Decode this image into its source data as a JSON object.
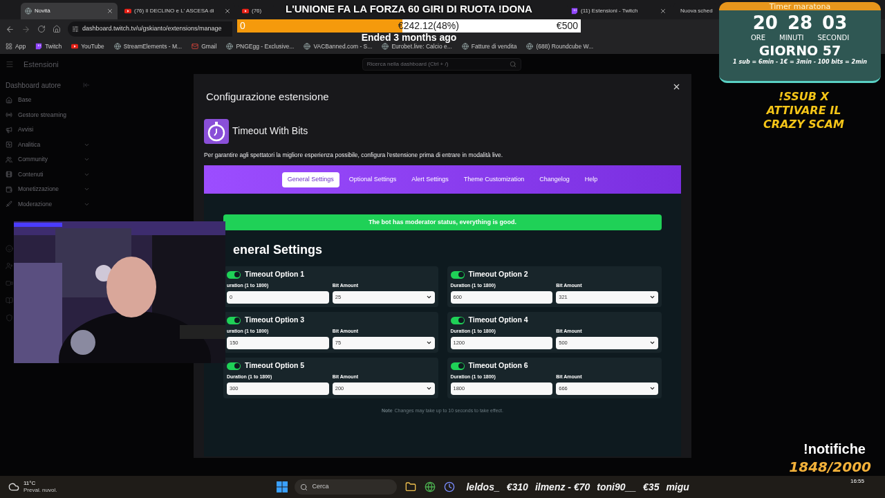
{
  "browser": {
    "tabs": [
      {
        "title": "Novità",
        "selected": true,
        "kind": "globe"
      },
      {
        "title": "(76) Il DECLINO e L' ASCESA di",
        "selected": false,
        "kind": "youtube"
      },
      {
        "title": "(76)",
        "selected": false,
        "kind": "youtube"
      },
      {
        "title": "(11) Estensioni - Twitch",
        "selected": false,
        "kind": "twitch"
      },
      {
        "title": "Nuova sched",
        "selected": false,
        "kind": "globe"
      }
    ],
    "address": "dashboard.twitch.tv/u/gskianto/extensions/manage",
    "bookmarks": [
      {
        "label": "App",
        "kind": "apps"
      },
      {
        "label": "Twitch",
        "kind": "twitch"
      },
      {
        "label": "YouTube",
        "kind": "youtube"
      },
      {
        "label": "StreamElements - M...",
        "kind": "globe"
      },
      {
        "label": "Gmail",
        "kind": "mail"
      },
      {
        "label": "PNGEgg - Exclusive...",
        "kind": "globe"
      },
      {
        "label": "VACBanned.com - S...",
        "kind": "globe"
      },
      {
        "label": "Eurobet.live: Calcio e...",
        "kind": "globe"
      },
      {
        "label": "Fatture di vendita",
        "kind": "globe"
      },
      {
        "label": "(688) Roundcube W...",
        "kind": "globe"
      }
    ]
  },
  "dashboard": {
    "section": "Estensioni",
    "search": {
      "placeholder": "Ricerca nella dashboard (Ctrl + /)"
    },
    "sidebar": {
      "title": "Dashboard autore",
      "items": [
        {
          "label": "Base",
          "has_submenu": false
        },
        {
          "label": "Gestore streaming",
          "has_submenu": false
        },
        {
          "label": "Avvisi",
          "has_submenu": false
        },
        {
          "label": "Analitica",
          "has_submenu": true
        },
        {
          "label": "Community",
          "has_submenu": true
        },
        {
          "label": "Contenuti",
          "has_submenu": true
        },
        {
          "label": "Monetizzazione",
          "has_submenu": true
        },
        {
          "label": "Moderazione",
          "has_submenu": true
        }
      ]
    }
  },
  "modal": {
    "title": "Configurazione estensione",
    "extension": "Timeout With Bits",
    "description": "Per garantire agli spettatori la migliore esperienza possibile, configura l'estensione prima di entrare in modalità live.",
    "tabs": [
      {
        "label": "General Settings",
        "selected": true
      },
      {
        "label": "Optional Settings",
        "selected": false
      },
      {
        "label": "Alert Settings",
        "selected": false
      },
      {
        "label": "Theme Customization",
        "selected": false
      },
      {
        "label": "Changelog",
        "selected": false
      },
      {
        "label": "Help",
        "selected": false
      }
    ],
    "banner": "The bot has moderator status, everything is good.",
    "heading": "eneral Settings",
    "options": [
      {
        "title": "Timeout Option 1",
        "enabled": true,
        "duration_label": "uration (1 to 1800)",
        "duration": "0",
        "bit_label": "Bit Amount",
        "bits": "25"
      },
      {
        "title": "Timeout Option 2",
        "enabled": true,
        "duration_label": "Duration (1 to 1800)",
        "duration": "600",
        "bit_label": "Bit Amount",
        "bits": "321"
      },
      {
        "title": "Timeout Option 3",
        "enabled": true,
        "duration_label": "uration (1 to 1800)",
        "duration": "150",
        "bit_label": "Bit Amount",
        "bits": "75"
      },
      {
        "title": "Timeout Option 4",
        "enabled": true,
        "duration_label": "Duration (1 to 1800)",
        "duration": "1200",
        "bit_label": "Bit Amount",
        "bits": "500"
      },
      {
        "title": "Timeout Option 5",
        "enabled": true,
        "duration_label": "Duration (1 to 1800)",
        "duration": "300",
        "bit_label": "Bit Amount",
        "bits": "200"
      },
      {
        "title": "Timeout Option 6",
        "enabled": true,
        "duration_label": "Duration (1 to 1800)",
        "duration": "1800",
        "bit_label": "Bit Amount",
        "bits": "666"
      }
    ],
    "note": {
      "label": "Note",
      "text": "Changes may take up to 10 seconds to take effect."
    }
  },
  "stream_overlay": {
    "donation": {
      "title": "L'UNIONE FA LA FORZA 60 GIRI DI RUOTA !DONA",
      "start": "0",
      "amount": "€242.12(48%)",
      "goal": "€500",
      "level": 0.48,
      "status": "Ended 3 months ago"
    },
    "timer": {
      "title": "Timer maratona",
      "hours": "20",
      "minutes": "28",
      "seconds": "03",
      "hours_label": "ORE",
      "minutes_label": "MINUTI",
      "seconds_label": "SECONDI",
      "day": "GIORNO 57",
      "rates": "1 sub = 6min - 1€ = 3min - 100 bits = 2min"
    },
    "callout": [
      "!SSUB X",
      "ATTIVARE IL",
      "CRAZY SCAM"
    ],
    "command": "!notifiche",
    "counter": "1848/2000"
  },
  "taskbar": {
    "weather": {
      "temp": "11°C",
      "desc": "Preval. nuvol."
    },
    "search": "Cerca",
    "ticker": [
      "leldos_",
      "€310",
      "ilmenz - €70",
      "toni90__",
      "€35",
      "migu"
    ],
    "clock": "16:55"
  }
}
